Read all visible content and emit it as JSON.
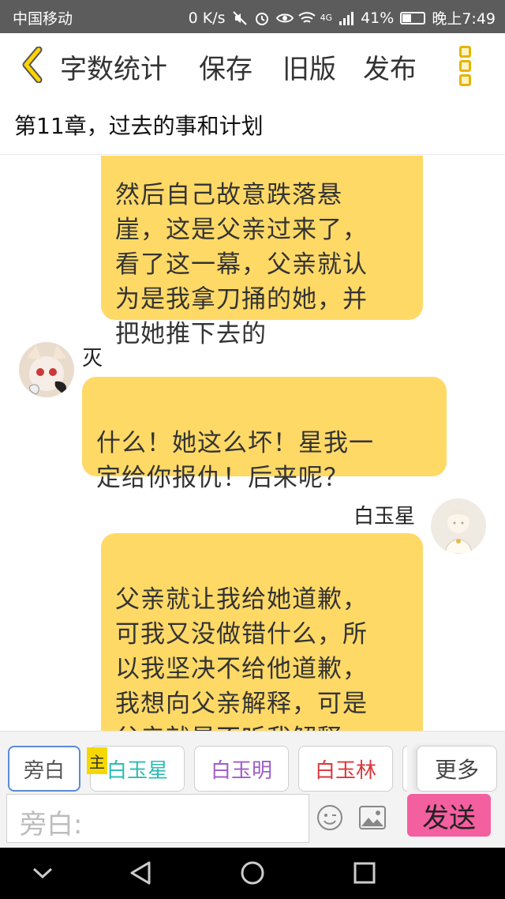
{
  "status_bar": {
    "carrier": "中国移动",
    "speed": "0 K/s",
    "network": "4G",
    "battery_text": "41%",
    "battery_level": 0.41,
    "time": "晚上7:49"
  },
  "toolbar": {
    "word_count": "字数统计",
    "save": "保存",
    "old_version": "旧版",
    "publish": "发布"
  },
  "chapter": {
    "title": "第11章，过去的事和计划"
  },
  "messages": [
    {
      "side": "right",
      "text": "然后自己故意跌落悬\n崖，这是父亲过来了，\n看了这一幕，父亲就认\n为是我拿刀捅的她，并\n把她推下去的"
    },
    {
      "side": "left",
      "sender": "灭",
      "text": "什么！她这么坏！星我一\n定给你报仇！后来呢？"
    },
    {
      "side": "right",
      "sender": "白玉星",
      "text": "父亲就让我给她道歉，\n可我又没做错什么，所\n以我坚决不给他道歉，\n我想向父亲解释，可是\n父亲就是不听我解释，\n直接一巴掌打在我脸"
    }
  ],
  "roles": {
    "items": [
      {
        "label": "旁白",
        "color": "#555555"
      },
      {
        "label": "白玉星",
        "color": "#2bbcb3"
      },
      {
        "label": "白玉明",
        "color": "#a05cc9"
      },
      {
        "label": "白玉林",
        "color": "#d9393c"
      }
    ],
    "main_badge": "主",
    "more": "更多"
  },
  "input": {
    "label": "旁白:"
  },
  "send": "发送",
  "colors": {
    "bubble": "#ffd966",
    "send": "#f45fa0",
    "accent": "#e6b400"
  }
}
